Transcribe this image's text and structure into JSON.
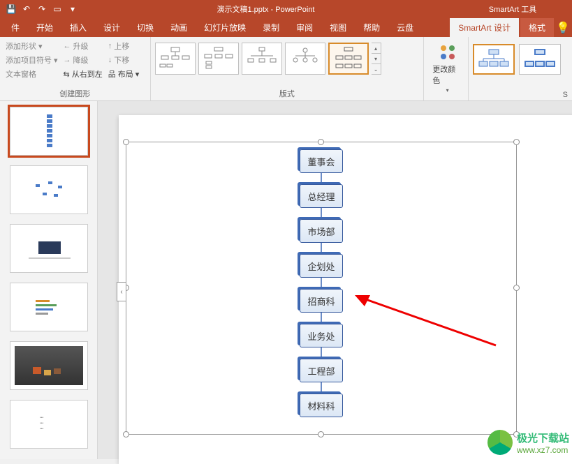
{
  "titlebar": {
    "doc_title": "演示文稿1.pptx - PowerPoint",
    "tool_context": "SmartArt 工具"
  },
  "tabs": {
    "file": "件",
    "home": "开始",
    "insert": "插入",
    "design": "设计",
    "transitions": "切换",
    "animations": "动画",
    "slideshow": "幻灯片放映",
    "record": "录制",
    "review": "审阅",
    "view": "视图",
    "help": "帮助",
    "cloud": "云盘",
    "smartart_design": "SmartArt 设计",
    "format": "格式"
  },
  "ribbon": {
    "create_graphic": {
      "add_shape": "添加形状",
      "add_bullet": "添加项目符号",
      "text_pane": "文本窗格",
      "promote": "升级",
      "demote": "降级",
      "rtl": "从右到左",
      "move_up": "上移",
      "move_down": "下移",
      "layout": "布局",
      "group_label": "创建图形"
    },
    "layouts_group_label": "版式",
    "change_colors": "更改颜色",
    "styles_group_label": "S"
  },
  "smartart_nodes": [
    "董事会",
    "总经理",
    "市场部",
    "企划处",
    "招商科",
    "业务处",
    "工程部",
    "材料科"
  ],
  "collapse_glyph": "‹",
  "watermark": {
    "cn": "极光下载站",
    "url": "www.xz7.com"
  }
}
